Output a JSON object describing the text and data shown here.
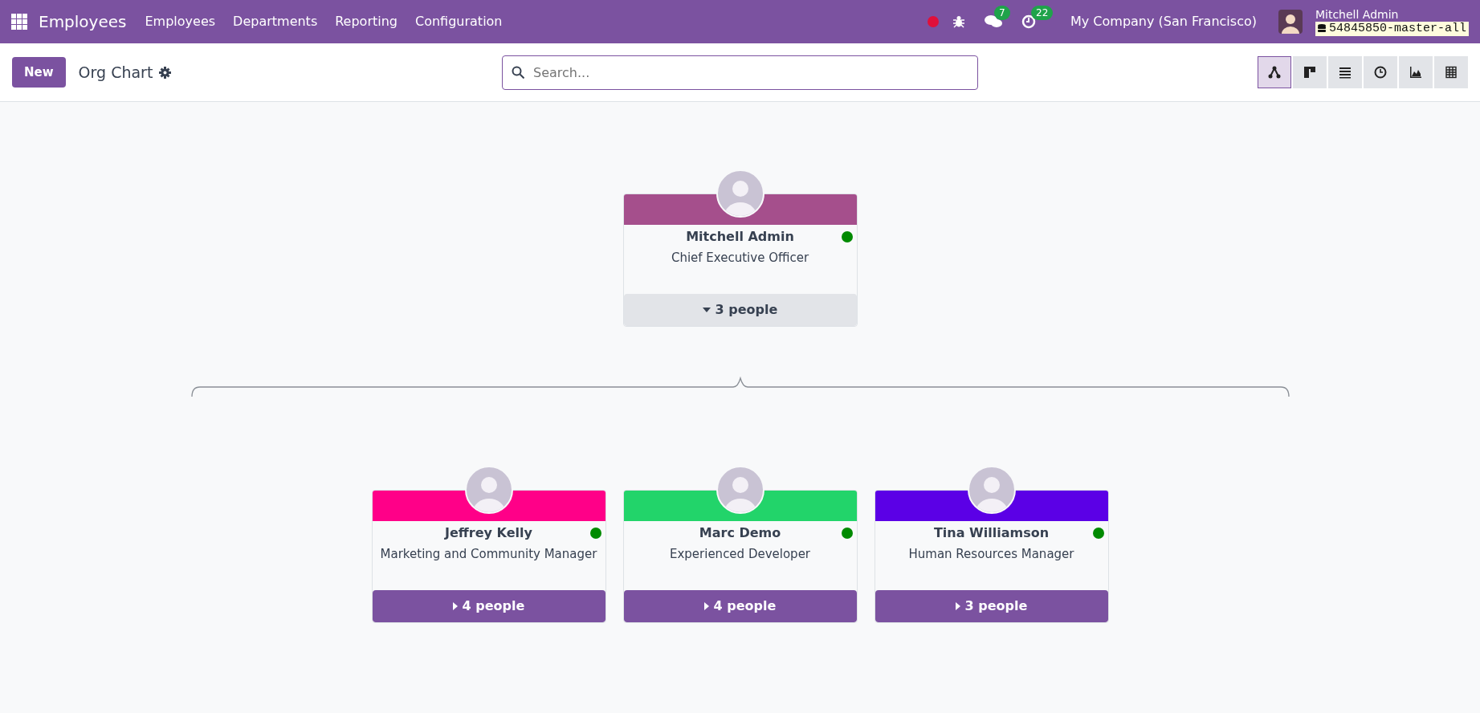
{
  "navbar": {
    "app": "Employees",
    "menus": [
      "Employees",
      "Departments",
      "Reporting",
      "Configuration"
    ],
    "chat_count": "7",
    "activity_count": "22",
    "company": "My Company (San Francisco)",
    "user": "Mitchell Admin",
    "database": "54845850-master-all"
  },
  "control_panel": {
    "new_button": "New",
    "title": "Org Chart",
    "search_placeholder": "Search...",
    "views": [
      {
        "kind": "hierarchy",
        "selected": true
      },
      {
        "kind": "kanban",
        "selected": false
      },
      {
        "kind": "list",
        "selected": false
      },
      {
        "kind": "activity",
        "selected": false
      },
      {
        "kind": "graph",
        "selected": false
      },
      {
        "kind": "pivot",
        "selected": false
      }
    ]
  },
  "org_chart": {
    "root": {
      "name": "Mitchell Admin",
      "job": "Chief Executive Officer",
      "color": "#a54f8c",
      "online": true,
      "people": "3 people",
      "expanded": true
    },
    "children": [
      {
        "name": "Jeffrey Kelly",
        "job": "Marketing and Community Manager",
        "color": "#ff0088",
        "online": true,
        "people": "4 people",
        "expanded": false
      },
      {
        "name": "Marc Demo",
        "job": "Experienced Developer",
        "color": "#22d46a",
        "online": true,
        "people": "4 people",
        "expanded": false
      },
      {
        "name": "Tina Williamson",
        "job": "Human Resources Manager",
        "color": "#5b00e6",
        "online": true,
        "people": "3 people",
        "expanded": false
      }
    ]
  }
}
